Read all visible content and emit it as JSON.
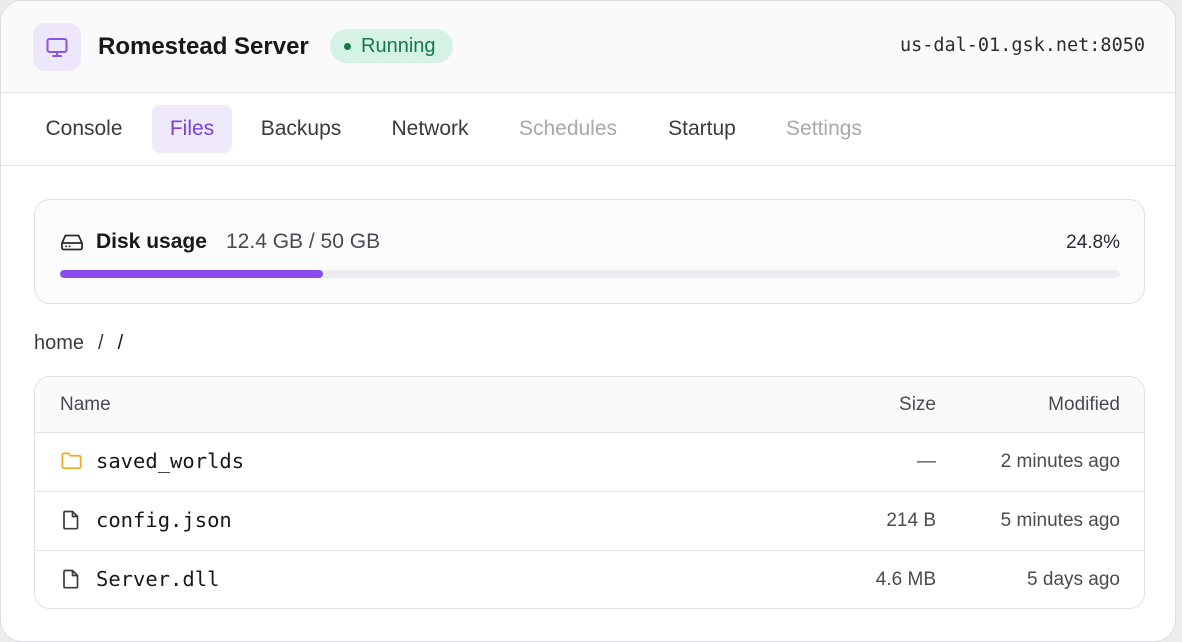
{
  "header": {
    "server_name": "Romestead Server",
    "status": "Running",
    "address": "us-dal-01.gsk.net:8050",
    "icon": "monitor-icon"
  },
  "tabs": [
    {
      "label": "Console",
      "state": "normal"
    },
    {
      "label": "Files",
      "state": "active"
    },
    {
      "label": "Backups",
      "state": "normal"
    },
    {
      "label": "Network",
      "state": "normal"
    },
    {
      "label": "Schedules",
      "state": "disabled"
    },
    {
      "label": "Startup",
      "state": "normal"
    },
    {
      "label": "Settings",
      "state": "disabled"
    }
  ],
  "disk": {
    "label": "Disk usage",
    "value": "12.4 GB / 50 GB",
    "percent_text": "24.8%",
    "fill_fraction": 0.248
  },
  "breadcrumb": {
    "root": "home",
    "sep1": "/",
    "sep2": "/"
  },
  "files": {
    "columns": {
      "name": "Name",
      "size": "Size",
      "modified": "Modified"
    },
    "rows": [
      {
        "name": "saved_worlds",
        "size": "—",
        "modified": "2 minutes ago",
        "icon": "folder-icon"
      },
      {
        "name": "config.json",
        "size": "214 B",
        "modified": "5 minutes ago",
        "icon": "file-icon"
      },
      {
        "name": "Server.dll",
        "size": "4.6 MB",
        "modified": "5 days ago",
        "icon": "file-icon"
      }
    ]
  },
  "colors": {
    "accent": "#8b4bee",
    "status_bg": "#d5f3e4",
    "status_fg": "#14784a",
    "folder": "#f0a81c"
  }
}
